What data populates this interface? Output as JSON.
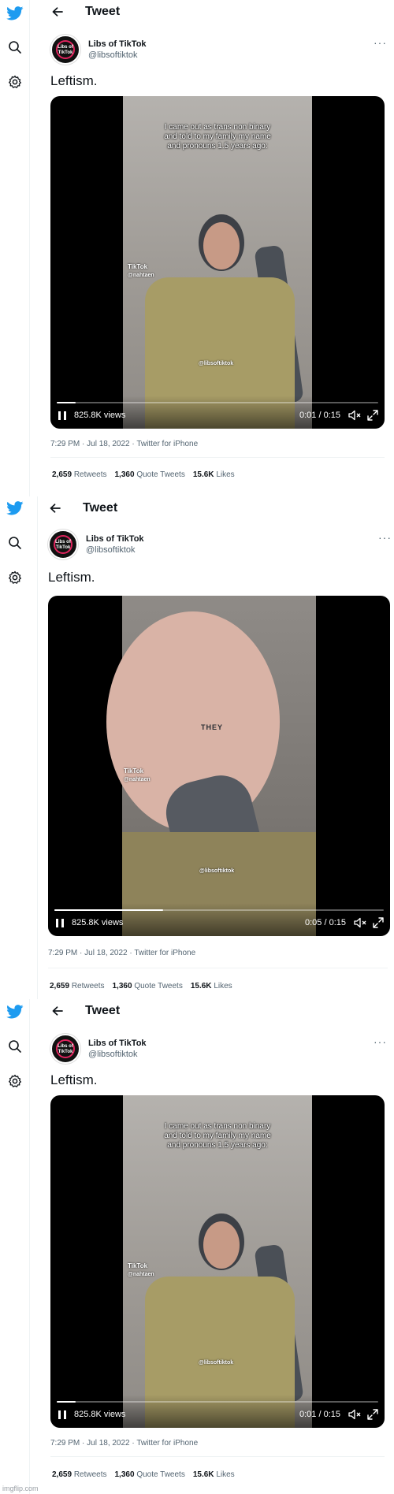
{
  "panels": [
    {
      "header": {
        "title": "Tweet"
      },
      "author": {
        "display_name": "Libs of TikTok",
        "handle": "@libsoftiktok",
        "avatar_mark": "Libs of TikTok"
      },
      "tweet_text": "Leftism.",
      "video": {
        "caption": "I came out as trans non binary and told to my family my name and pronouns 1.5 years ago:",
        "tiktok_label": "TikTok",
        "tiktok_user": "@nahtaen",
        "watermark": "@libsoftiktok",
        "views": "825.8K views",
        "time": "0:01 / 0:15",
        "progress": 0.06,
        "scene": "wide"
      },
      "meta": "7:29 PM · Jul 18, 2022 · Twitter for iPhone",
      "stats": [
        {
          "count": "2,659",
          "label": "Retweets"
        },
        {
          "count": "1,360",
          "label": "Quote Tweets"
        },
        {
          "count": "15.6K",
          "label": "Likes"
        }
      ]
    },
    {
      "header": {
        "title": "Tweet"
      },
      "author": {
        "display_name": "Libs of TikTok",
        "handle": "@libsoftiktok",
        "avatar_mark": "Libs of TikTok"
      },
      "tweet_text": "Leftism.",
      "video": {
        "caption": "",
        "tiktok_label": "TikTok",
        "tiktok_user": "@nahtaen",
        "watermark": "@libsoftiktok",
        "face_text": "THEY",
        "views": "825.8K views",
        "time": "0:05 / 0:15",
        "progress": 0.33,
        "scene": "close"
      },
      "meta": "7:29 PM · Jul 18, 2022 · Twitter for iPhone",
      "stats": [
        {
          "count": "2,659",
          "label": "Retweets"
        },
        {
          "count": "1,360",
          "label": "Quote Tweets"
        },
        {
          "count": "15.6K",
          "label": "Likes"
        }
      ]
    },
    {
      "header": {
        "title": "Tweet"
      },
      "author": {
        "display_name": "Libs of TikTok",
        "handle": "@libsoftiktok",
        "avatar_mark": "Libs of TikTok"
      },
      "tweet_text": "Leftism.",
      "video": {
        "caption": "I came out as trans non binary and told to my family my name and pronouns 1.5 years ago:",
        "tiktok_label": "TikTok",
        "tiktok_user": "@nahtaen",
        "watermark": "@libsoftiktok",
        "views": "825.8K views",
        "time": "0:01 / 0:15",
        "progress": 0.06,
        "scene": "wide"
      },
      "meta": "7:29 PM · Jul 18, 2022 · Twitter for iPhone",
      "stats": [
        {
          "count": "2,659",
          "label": "Retweets"
        },
        {
          "count": "1,360",
          "label": "Quote Tweets"
        },
        {
          "count": "15.6K",
          "label": "Likes"
        }
      ]
    }
  ],
  "footer_watermark": "imgflip.com",
  "colors": {
    "twitter_blue": "#1d9bf0",
    "text_primary": "#0f1419",
    "text_secondary": "#536471"
  },
  "icons": [
    "twitter-bird-icon",
    "search-icon",
    "gear-icon",
    "back-arrow-icon",
    "more-icon",
    "pause-icon",
    "volume-icon",
    "fullscreen-icon"
  ]
}
